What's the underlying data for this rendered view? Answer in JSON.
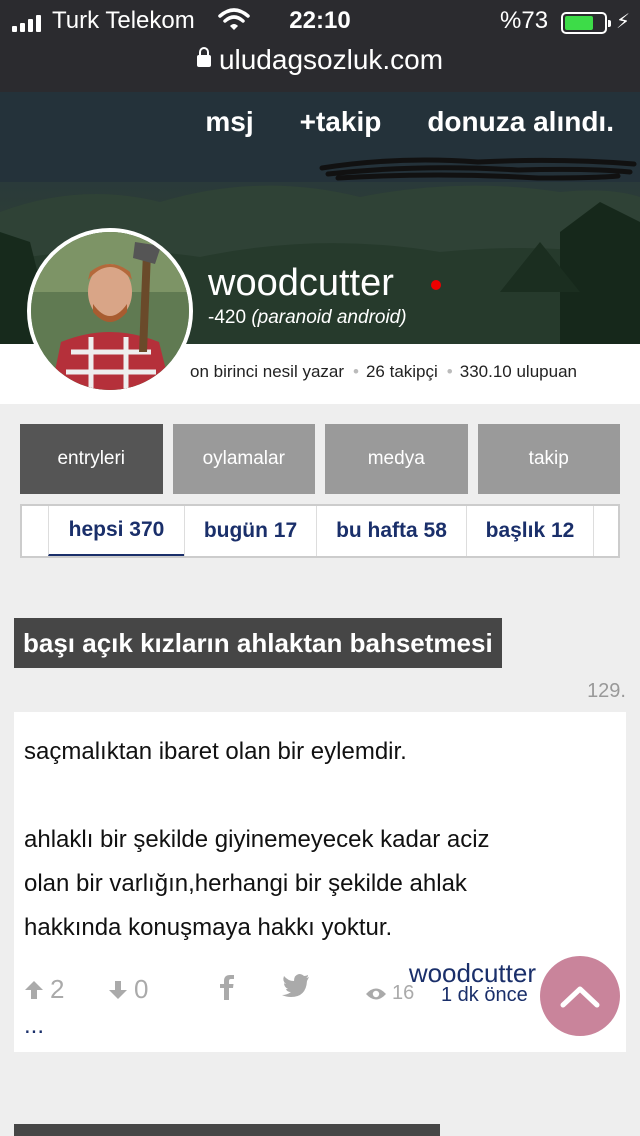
{
  "status_bar": {
    "carrier": "Turk Telekom",
    "time": "22:10",
    "battery_percent": "%73",
    "battery_level": 0.73,
    "battery_color": "#3ddc48"
  },
  "browser": {
    "url": "uludagsozluk.com"
  },
  "cover_nav": {
    "message": "msj",
    "follow": "+takip",
    "donation": "donuza alındı."
  },
  "profile": {
    "username": "woodcutter",
    "karma": "-420",
    "karma_title": "(paranoid android)",
    "generation": "on birinci nesil yazar",
    "followers": "26 takipçi",
    "points": "330.10 ulupuan",
    "online_color": "#e00000"
  },
  "tabs": [
    {
      "label": "entryleri"
    },
    {
      "label": "oylamalar"
    },
    {
      "label": "medya"
    },
    {
      "label": "takip"
    }
  ],
  "subtabs": [
    {
      "label": "hepsi 370"
    },
    {
      "label": "bugün 17"
    },
    {
      "label": "bu hafta 58"
    },
    {
      "label": "başlık 12"
    }
  ],
  "entry": {
    "topic": "başı açık kızların ahlaktan bahsetmesi",
    "number": "129.",
    "line1": "saçmalıktan ibaret olan bir eylemdir.",
    "line2": "ahlaklı bir şekilde giyinemeyecek kadar aciz",
    "line3": "olan bir varlığın,herhangi bir şekilde ahlak",
    "line4": "hakkında konuşmaya hakkı yoktur.",
    "author": "woodcutter",
    "upvotes": "2",
    "downvotes": "0",
    "views": "16",
    "time": "1 dk önce",
    "more": "..."
  },
  "icons": {
    "upvote": "arrow-up-icon",
    "downvote": "arrow-down-icon",
    "share_facebook": "facebook-icon",
    "share_twitter": "twitter-icon",
    "views": "eye-icon",
    "scroll_top": "chevron-up-icon"
  },
  "colors": {
    "link": "#1a2f6a",
    "scroll_button": "#c9849b",
    "topic_bg": "#464646",
    "active_tab": "#555555",
    "inactive_tab": "#9a9a9a"
  }
}
